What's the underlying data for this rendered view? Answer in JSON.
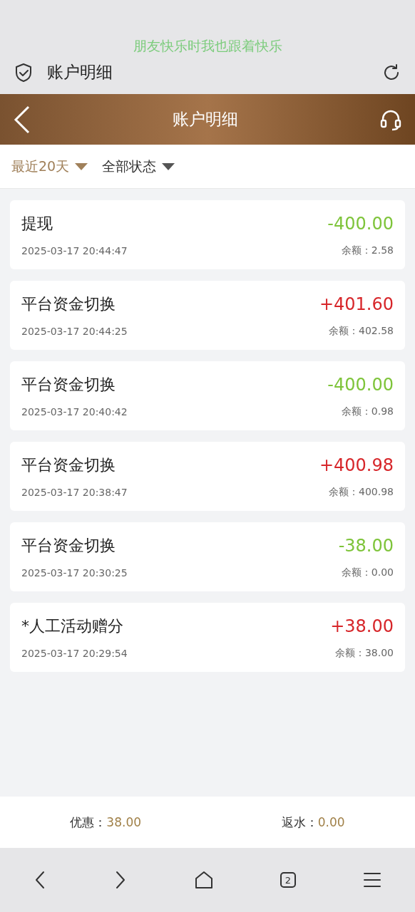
{
  "browser": {
    "caption": "朋友快乐时我也跟着快乐",
    "title": "账户明细"
  },
  "header": {
    "title": "账户明细"
  },
  "filters": [
    {
      "label": "最近20天",
      "selected": true
    },
    {
      "label": "全部状态",
      "selected": false
    }
  ],
  "records": [
    {
      "title": "提现",
      "time": "2025-03-17 20:44:47",
      "amount": "-400.00",
      "color": "#7ec43a",
      "balance_label": "余额：",
      "balance": "2.58"
    },
    {
      "title": "平台资金切换",
      "time": "2025-03-17 20:44:25",
      "amount": "+401.60",
      "color": "#d7262a",
      "balance_label": "余额：",
      "balance": "402.58"
    },
    {
      "title": "平台资金切换",
      "time": "2025-03-17 20:40:42",
      "amount": "-400.00",
      "color": "#7ec43a",
      "balance_label": "余额：",
      "balance": "0.98"
    },
    {
      "title": "平台资金切换",
      "time": "2025-03-17 20:38:47",
      "amount": "+400.98",
      "color": "#d7262a",
      "balance_label": "余额：",
      "balance": "400.98"
    },
    {
      "title": "平台资金切换",
      "time": "2025-03-17 20:30:25",
      "amount": "-38.00",
      "color": "#7ec43a",
      "balance_label": "余额：",
      "balance": "0.00"
    },
    {
      "title": "*人工活动赠分",
      "time": "2025-03-17 20:29:54",
      "amount": "+38.00",
      "color": "#d7262a",
      "balance_label": "余额：",
      "balance": "38.00"
    }
  ],
  "summary": [
    {
      "label": "优惠：",
      "value": "38.00"
    },
    {
      "label": "返水：",
      "value": "0.00"
    }
  ],
  "nav": {
    "tabs_count": "2"
  }
}
